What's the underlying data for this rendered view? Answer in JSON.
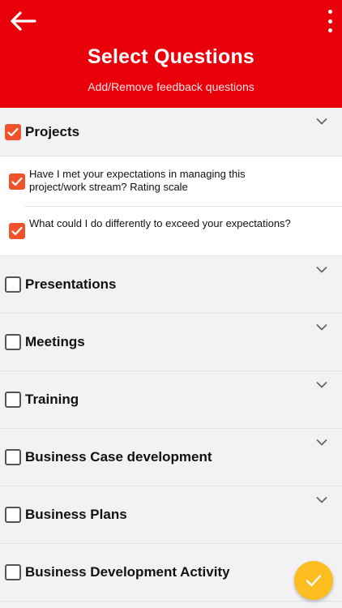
{
  "header": {
    "title": "Select Questions",
    "subtitle": "Add/Remove feedback questions",
    "bg_color": "#e8000b"
  },
  "icons": {
    "back": "arrow-left-icon",
    "menu": "more-vertical-icon",
    "expand": "chevron-down-icon",
    "confirm": "check-icon"
  },
  "sections": [
    {
      "label": "Projects",
      "checked": true,
      "expanded": true,
      "questions": [
        {
          "text": "Have I met your expectations in managing this project/work stream? Rating scale",
          "checked": true
        },
        {
          "text": "What could I do differently to exceed your expectations?",
          "checked": true
        }
      ]
    },
    {
      "label": "Presentations",
      "checked": false,
      "expanded": false
    },
    {
      "label": "Meetings",
      "checked": false,
      "expanded": false
    },
    {
      "label": "Training",
      "checked": false,
      "expanded": false
    },
    {
      "label": "Business Case development",
      "checked": false,
      "expanded": false
    },
    {
      "label": "Business Plans",
      "checked": false,
      "expanded": false
    },
    {
      "label": "Business Development Activity",
      "checked": false,
      "expanded": false
    }
  ],
  "colors": {
    "accent": "#f0532a",
    "fab": "#fbbd20"
  }
}
